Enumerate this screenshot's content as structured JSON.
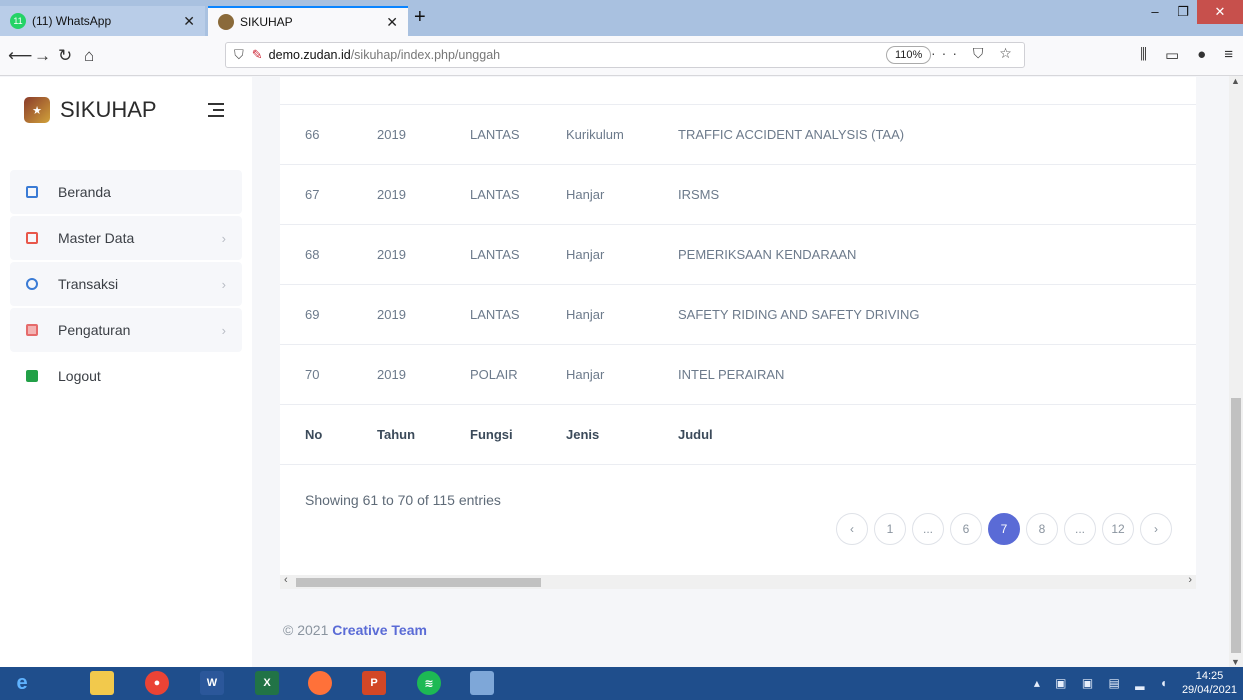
{
  "browser": {
    "tabs": [
      {
        "label": "(11) WhatsApp",
        "badge": "11",
        "favicon": "whatsapp-icon"
      },
      {
        "label": "SIKUHAP",
        "favicon": "sikuhap-icon"
      }
    ],
    "url_host": "demo.zudan.id",
    "url_path": "/sikuhap/index.php/unggah",
    "zoom": "110%"
  },
  "sidebar": {
    "brand": "SIKUHAP",
    "items": [
      {
        "label": "Beranda",
        "icon": "home-icon"
      },
      {
        "label": "Master Data",
        "icon": "database-icon"
      },
      {
        "label": "Transaksi",
        "icon": "transaction-icon"
      },
      {
        "label": "Pengaturan",
        "icon": "settings-icon"
      },
      {
        "label": "Logout",
        "icon": "logout-icon"
      }
    ]
  },
  "table": {
    "rows": [
      {
        "no": "66",
        "tahun": "2019",
        "fungsi": "LANTAS",
        "jenis": "Kurikulum",
        "judul": "TRAFFIC ACCIDENT ANALYSIS (TAA)"
      },
      {
        "no": "67",
        "tahun": "2019",
        "fungsi": "LANTAS",
        "jenis": "Hanjar",
        "judul": "IRSMS"
      },
      {
        "no": "68",
        "tahun": "2019",
        "fungsi": "LANTAS",
        "jenis": "Hanjar",
        "judul": "PEMERIKSAAN KENDARAAN"
      },
      {
        "no": "69",
        "tahun": "2019",
        "fungsi": "LANTAS",
        "jenis": "Hanjar",
        "judul": "SAFETY RIDING AND SAFETY DRIVING"
      },
      {
        "no": "70",
        "tahun": "2019",
        "fungsi": "POLAIR",
        "jenis": "Hanjar",
        "judul": "INTEL PERAIRAN"
      }
    ],
    "footer_headers": {
      "no": "No",
      "tahun": "Tahun",
      "fungsi": "Fungsi",
      "jenis": "Jenis",
      "judul": "Judul"
    },
    "info": "Showing 61 to 70 of 115 entries",
    "pagination": [
      "‹",
      "1",
      "...",
      "6",
      "7",
      "8",
      "...",
      "12",
      "›"
    ],
    "current_page": "7"
  },
  "footer": {
    "copyright": "© 2021",
    "team": "Creative Team"
  },
  "taskbar": {
    "time": "14:25",
    "date": "29/04/2021"
  },
  "colors": {
    "accent": "#5a6bd6",
    "taskbar": "#1f4e8c"
  }
}
